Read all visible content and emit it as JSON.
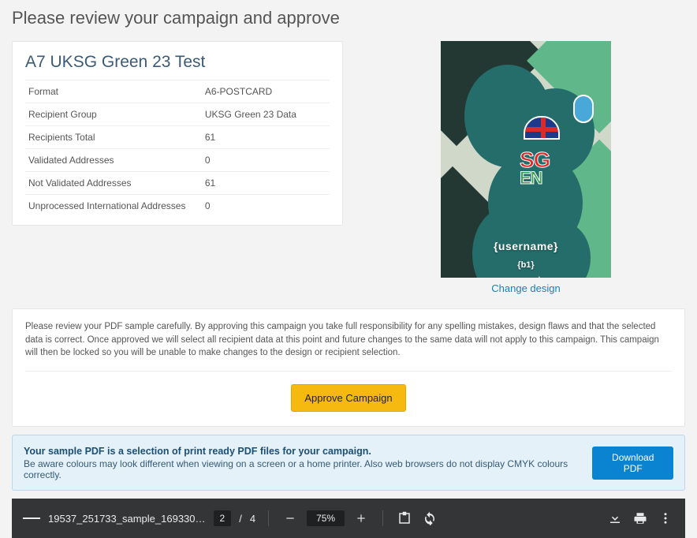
{
  "heading": "Please review your campaign and approve",
  "campaign": {
    "title": "A7 UKSG Green 23 Test",
    "rows": [
      {
        "label": "Format",
        "value": "A6-POSTCARD"
      },
      {
        "label": "Recipient Group",
        "value": "UKSG Green 23 Data"
      },
      {
        "label": "Recipients Total",
        "value": "61"
      },
      {
        "label": "Validated Addresses",
        "value": "0"
      },
      {
        "label": "Not Validated Addresses",
        "value": "61"
      },
      {
        "label": "Unprocessed International Addresses",
        "value": "0"
      }
    ]
  },
  "preview": {
    "overlay_username": "{username}",
    "overlay_b1": "{b1}",
    "logo_line1": "SG",
    "logo_line2": "EN",
    "change_link": "Change design"
  },
  "review": {
    "text": "Please review your PDF sample carefully. By approving this campaign you take full responsibility for any spelling mistakes, design flaws and that the selected data is correct. Once approved we will select all recipient data at this point and future changes to the same data will not apply to this campaign. This campaign will then be locked so you will be unable to make changes to the design or recipient selection.",
    "approve_label": "Approve Campaign"
  },
  "info": {
    "line1": "Your sample PDF is a selection of print ready PDF files for your campaign.",
    "line2": "Be aware colours may look different when viewing on a screen or a home printer. Also web browsers do not display CMYK colours correctly.",
    "download_label": "Download PDF"
  },
  "pdf": {
    "filename": "19537_251733_sample_169330…",
    "page_current": "2",
    "page_sep": "/",
    "page_total": "4",
    "zoom": "75%"
  }
}
